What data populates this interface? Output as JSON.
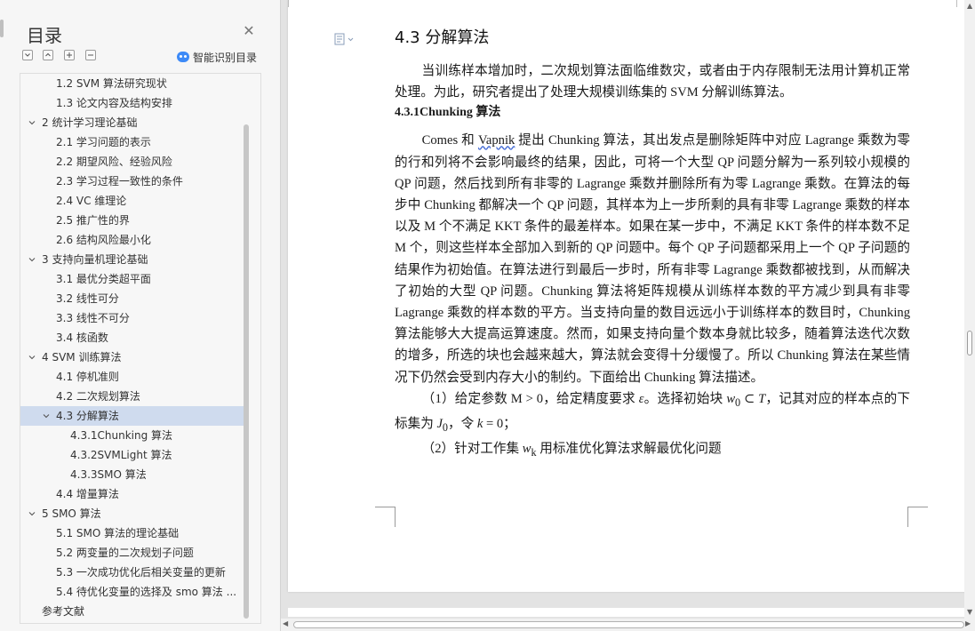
{
  "toc_pane": {
    "title": "目录",
    "smart_toc_label": "智能识别目录",
    "toolbar_icons": [
      "collapse-all-icon",
      "expand-icon",
      "add-icon",
      "remove-icon"
    ],
    "items": [
      {
        "label": "1.2 SVM 算法研究现状",
        "level": 2,
        "expanded": null,
        "selected": false
      },
      {
        "label": "1.3  论文内容及结构安排",
        "level": 2,
        "expanded": null,
        "selected": false
      },
      {
        "label": "2  统计学习理论基础",
        "level": 1,
        "expanded": true,
        "selected": false
      },
      {
        "label": "2.1  学习问题的表示",
        "level": 2,
        "expanded": null,
        "selected": false
      },
      {
        "label": "2.2  期望风险、经验风险",
        "level": 2,
        "expanded": null,
        "selected": false
      },
      {
        "label": "2.3  学习过程一致性的条件",
        "level": 2,
        "expanded": null,
        "selected": false
      },
      {
        "label": "2.4 VC 维理论",
        "level": 2,
        "expanded": null,
        "selected": false
      },
      {
        "label": "2.5  推广性的界",
        "level": 2,
        "expanded": null,
        "selected": false
      },
      {
        "label": "2.6  结构风险最小化",
        "level": 2,
        "expanded": null,
        "selected": false
      },
      {
        "label": "3  支持向量机理论基础",
        "level": 1,
        "expanded": true,
        "selected": false
      },
      {
        "label": "3.1  最优分类超平面",
        "level": 2,
        "expanded": null,
        "selected": false
      },
      {
        "label": "3.2  线性可分",
        "level": 2,
        "expanded": null,
        "selected": false
      },
      {
        "label": "3.3  线性不可分",
        "level": 2,
        "expanded": null,
        "selected": false
      },
      {
        "label": "3.4  核函数",
        "level": 2,
        "expanded": null,
        "selected": false
      },
      {
        "label": "4 SVM 训练算法",
        "level": 1,
        "expanded": true,
        "selected": false
      },
      {
        "label": "4.1  停机准则",
        "level": 2,
        "expanded": null,
        "selected": false
      },
      {
        "label": "4.2  二次规划算法",
        "level": 2,
        "expanded": null,
        "selected": false
      },
      {
        "label": "4.3  分解算法",
        "level": 2,
        "expanded": true,
        "selected": true
      },
      {
        "label": "4.3.1Chunking 算法",
        "level": 3,
        "expanded": null,
        "selected": false
      },
      {
        "label": "4.3.2SVMLight 算法",
        "level": 3,
        "expanded": null,
        "selected": false
      },
      {
        "label": "4.3.3SMO 算法",
        "level": 3,
        "expanded": null,
        "selected": false
      },
      {
        "label": "4.4  增量算法",
        "level": 2,
        "expanded": null,
        "selected": false
      },
      {
        "label": "5 SMO 算法",
        "level": 1,
        "expanded": true,
        "selected": false
      },
      {
        "label": "5.1 SMO 算法的理论基础",
        "level": 2,
        "expanded": null,
        "selected": false
      },
      {
        "label": "5.2  两变量的二次规划子问题",
        "level": 2,
        "expanded": null,
        "selected": false
      },
      {
        "label": "5.3  一次成功优化后相关变量的更新",
        "level": 2,
        "expanded": null,
        "selected": false
      },
      {
        "label": "5.4  待优化变量的选择及 smo 算法 ...",
        "level": 2,
        "expanded": null,
        "selected": false
      },
      {
        "label": "参考文献",
        "level": 0,
        "expanded": null,
        "selected": false
      }
    ]
  },
  "document": {
    "section_heading": "4.3  分解算法",
    "para_intro": "当训练样本增加时，二次规划算法面临维数灾，或者由于内存限制无法用计算机正常处理。为此，研究者提出了处理大规模训练集的 SVM 分解训练算法。",
    "subheading": "4.3.1Chunking 算法",
    "para_main_a": "Comes 和 ",
    "para_main_wavy": "Vapnik",
    "para_main_b": " 提出 Chunking 算法，其出发点是删除矩阵中对应 Lagrange 乘数为零的行和列将不会影响最终的结果，因此，可将一个大型 QP 问题分解为一系列较小规模的 QP 问题，然后找到所有非零的 Lagrange 乘数并删除所有为零 Lagrange 乘数。在算法的每步中 Chunking 都解决一个 QP 问题，其样本为上一步所剩的具有非零 Lagrange 乘数的样本以及 M 个不满足 KKT 条件的最差样本。如果在某一步中，不满足 KKT 条件的样本数不足 M 个，则这些样本全部加入到新的 QP 问题中。每个 QP 子问题都采用上一个 QP 子问题的结果作为初始值。在算法进行到最后一步时，所有非零 Lagrange 乘数都被找到，从而解决了初始的大型 QP 问题。Chunking 算法将矩阵规模从训练样本数的平方减少到具有非零 Lagrange 乘数的样本数的平方。当支持向量的数目远远小于训练样本的数目时，Chunking 算法能够大大提高运算速度。然而，如果支持向量个数本身就比较多，随着算法迭代次数的增多，所选的块也会越来越大，算法就会变得十分缓慢了。所以 Chunking 算法在某些情况下仍然会受到内存大小的制约。下面给出 Chunking 算法描述。",
    "item1_a": "（1）给定参数 M > 0，给定精度要求 ",
    "item1_eps": "ε",
    "item1_b": "。选择初始块 ",
    "item1_w": "w",
    "item1_w_sub": "0",
    "item1_c": " ⊂ ",
    "item1_T": "T",
    "item1_d": "，记其对应的样本点的下标集为 ",
    "item1_J": "J",
    "item1_J_sub": "0",
    "item1_e": "，令 ",
    "item1_k": "k",
    "item1_f": " = 0；",
    "item2_a": "（2）针对工作集 ",
    "item2_w": "w",
    "item2_w_sub": "k",
    "item2_b": " 用标准优化算法求解最优化问题"
  },
  "colors": {
    "selection": "#cfdbee",
    "ai_icon": "#3d8af7",
    "page": "#ffffff",
    "background": "#e3e3e3"
  }
}
